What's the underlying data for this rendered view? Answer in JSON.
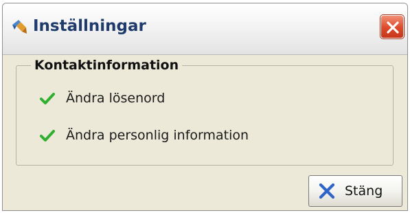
{
  "window": {
    "title": "Inställningar",
    "title_icon": "settings-app-icon",
    "close_icon": "close-icon"
  },
  "group": {
    "legend": "Kontaktinformation",
    "options": [
      {
        "label": "Ändra lösenord",
        "icon": "checkmark-icon"
      },
      {
        "label": "Ändra personlig information",
        "icon": "checkmark-icon"
      }
    ]
  },
  "footer": {
    "close_label": "Stäng",
    "close_icon": "x-icon"
  },
  "colors": {
    "title_text": "#1f3b6b",
    "window_bg": "#ece9d8",
    "check_green": "#2fae2f",
    "x_blue": "#2f64c9",
    "close_red": "#dc4a2a"
  }
}
